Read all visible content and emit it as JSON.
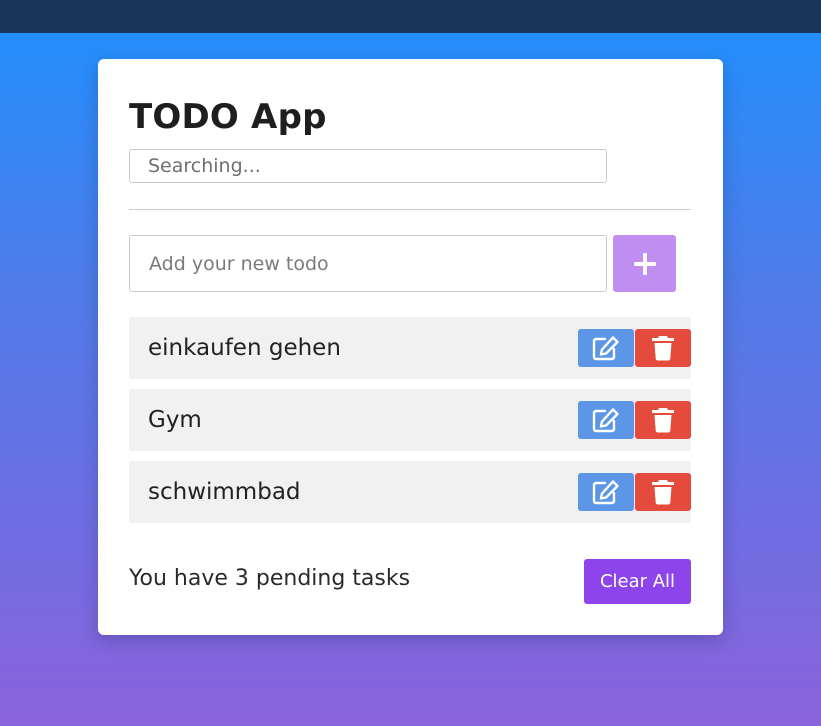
{
  "app": {
    "title": "TODO App",
    "search_placeholder": "Searching...",
    "new_todo_placeholder": "Add your new todo"
  },
  "icons": {
    "add": "plus-icon",
    "edit": "edit-icon",
    "delete": "trash-icon"
  },
  "colors": {
    "accent": "#8e44ec",
    "add_button": "#c08df0",
    "edit_button": "#5c96e6",
    "delete_button": "#e54b3c",
    "topbar": "#1b3559"
  },
  "todos": [
    {
      "text": "einkaufen gehen"
    },
    {
      "text": "Gym"
    },
    {
      "text": "schwimmbad"
    }
  ],
  "footer": {
    "pending_text": "You have 3 pending tasks",
    "clear_label": "Clear All"
  }
}
